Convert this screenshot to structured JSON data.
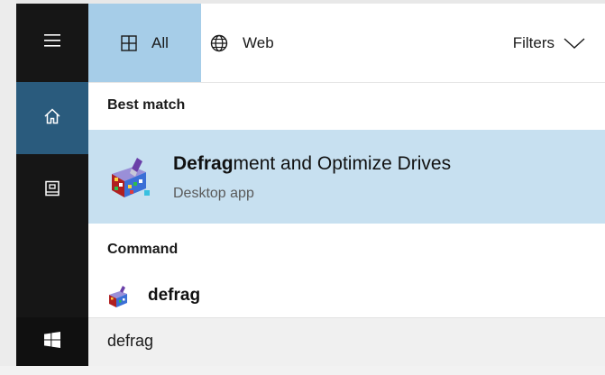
{
  "tabs": {
    "all_label": "All",
    "web_label": "Web",
    "filters_label": "Filters"
  },
  "best_match": {
    "section_label": "Best match",
    "title_bold": "Defrag",
    "title_rest": "ment and Optimize Drives",
    "subtitle": "Desktop app"
  },
  "command": {
    "section_label": "Command",
    "item_label": "defrag"
  },
  "search": {
    "value": "defrag"
  },
  "icons": {
    "menu": "hamburger-icon",
    "home": "home-icon",
    "documents": "documents-icon",
    "start": "windows-start-icon",
    "all": "grid-icon",
    "web": "globe-icon",
    "filters": "chevron-down-icon",
    "app": "defrag-app-icon"
  },
  "colors": {
    "selected_tab": "#a6cde8",
    "selected_result": "#c7e0f0",
    "rail": "#161616",
    "home_active": "#2a5b7d"
  }
}
